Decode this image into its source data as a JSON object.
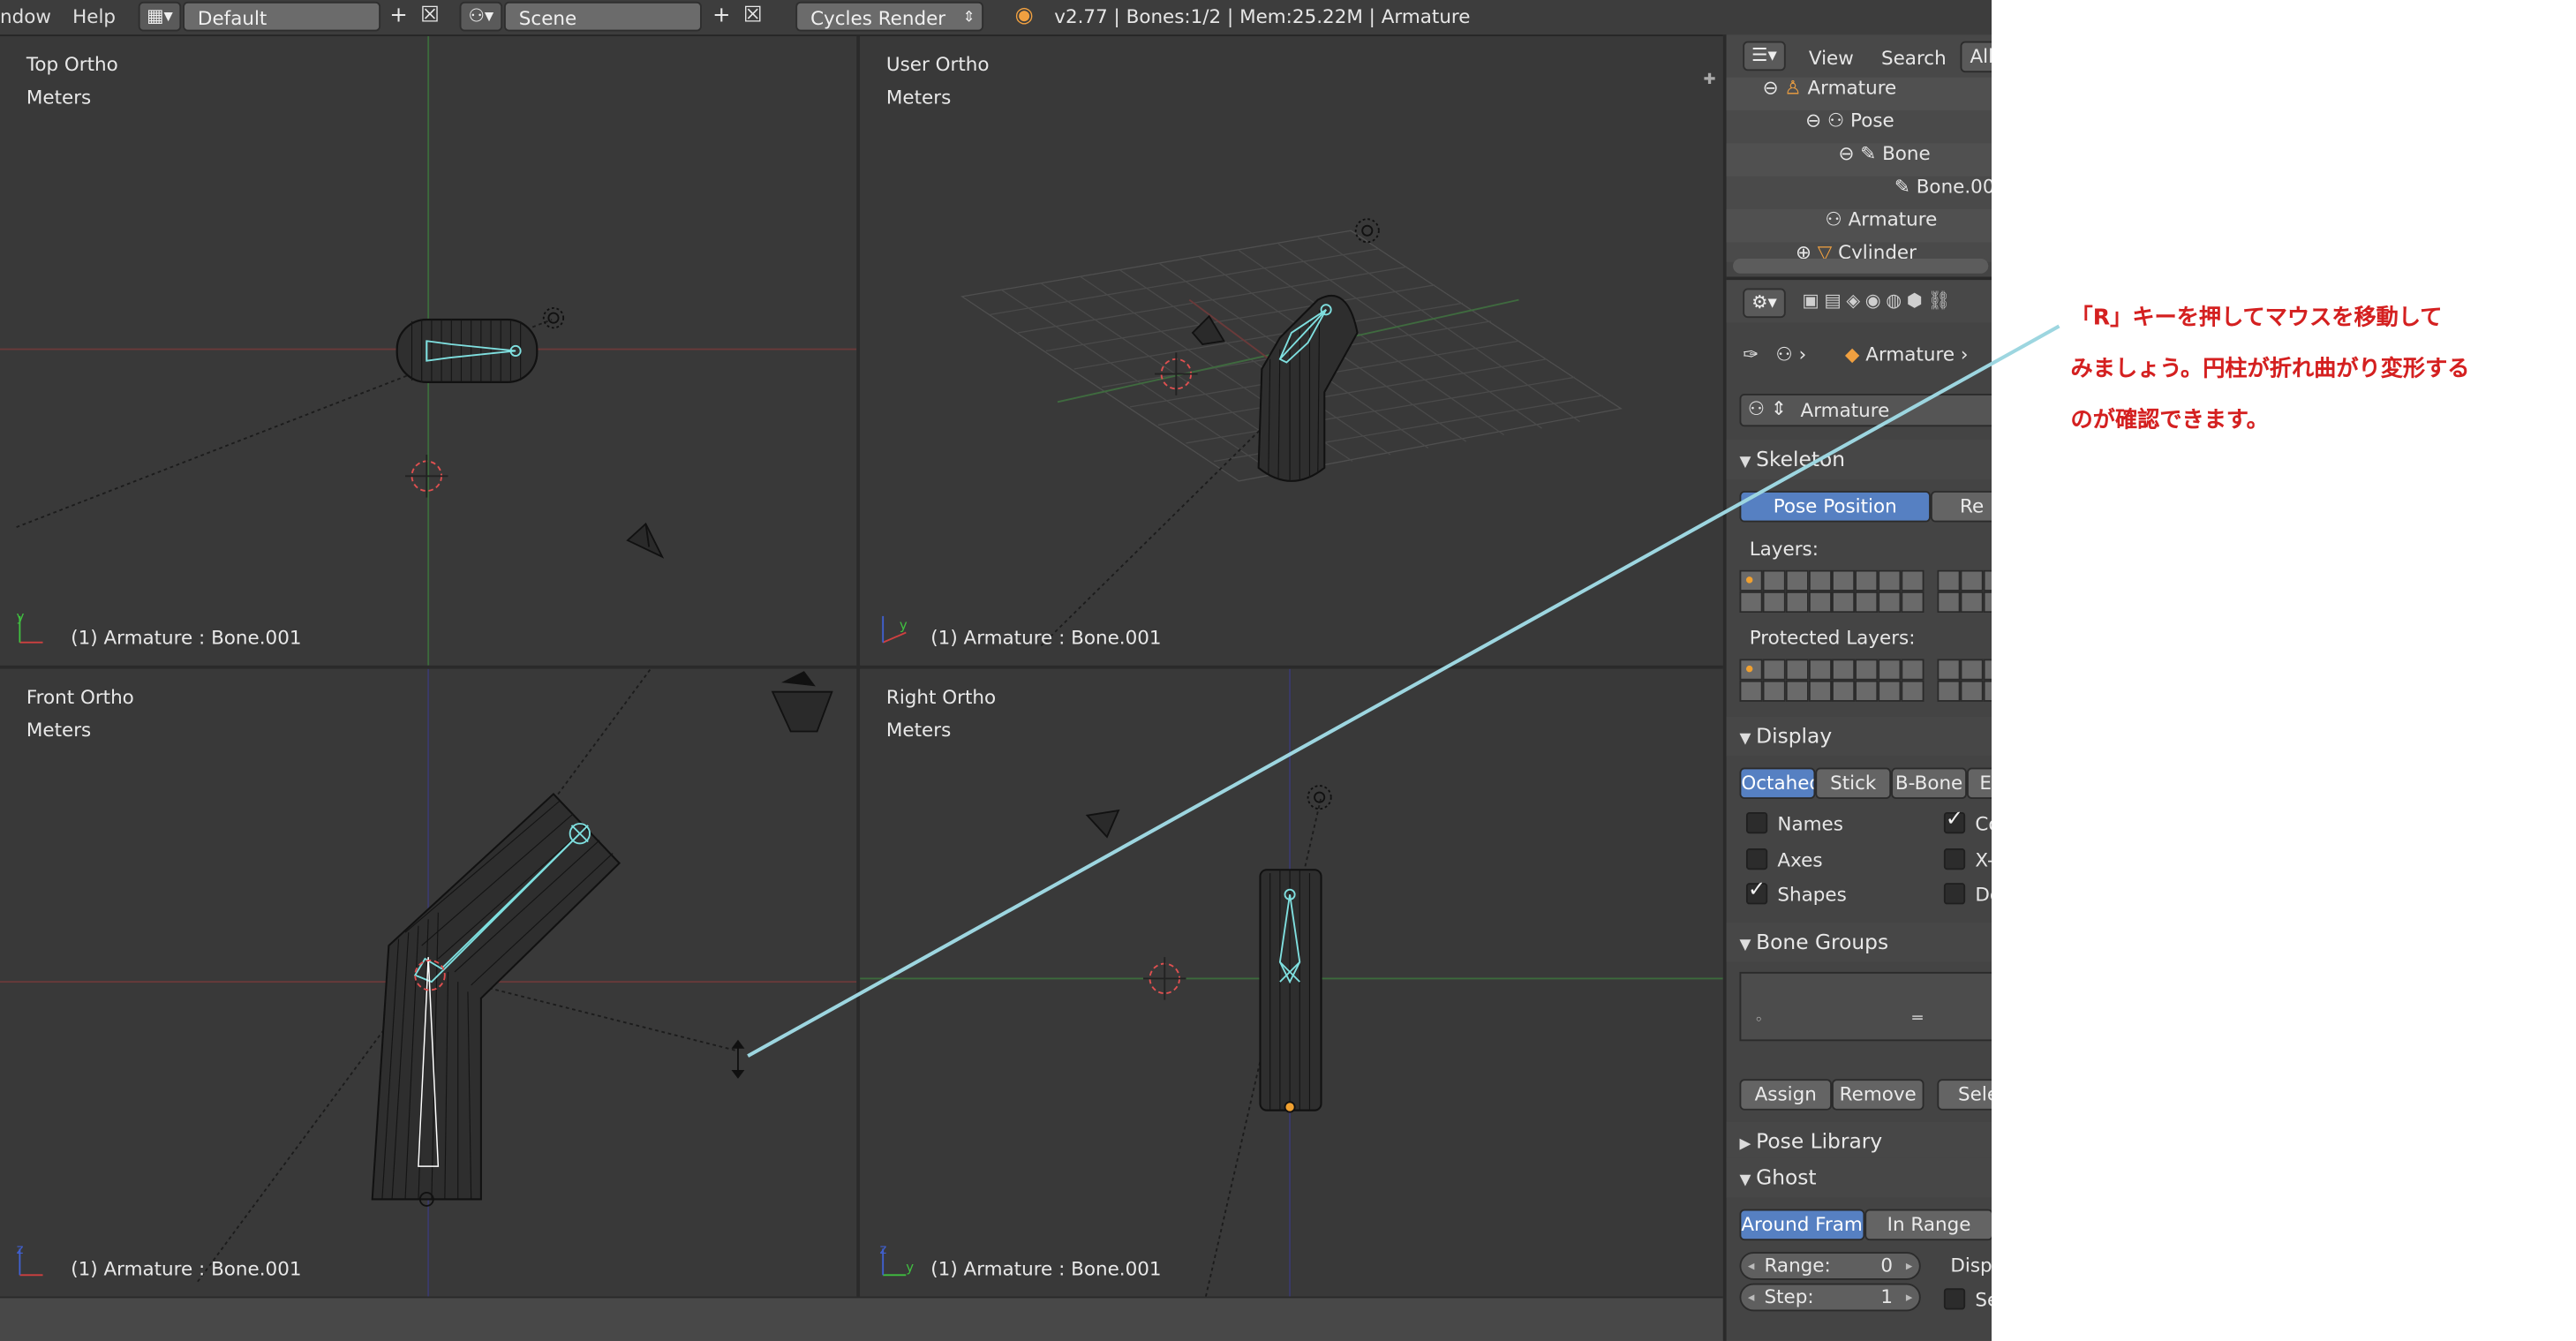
{
  "topbar": {
    "menu_window": "ndow",
    "menu_help": "Help",
    "layout_field": "Default",
    "scene_field": "Scene",
    "render_engine": "Cycles Render",
    "status": "v2.77 | Bones:1/2  | Mem:25.22M | Armature"
  },
  "viewports": {
    "top": {
      "title": "Top Ortho",
      "units": "Meters",
      "object": "(1) Armature : Bone.001"
    },
    "user": {
      "title": "User Ortho",
      "units": "Meters",
      "object": "(1) Armature : Bone.001"
    },
    "front": {
      "title": "Front Ortho",
      "units": "Meters",
      "object": "(1) Armature : Bone.001"
    },
    "right": {
      "title": "Right Ortho",
      "units": "Meters",
      "object": "(1) Armature : Bone.001"
    }
  },
  "outliner": {
    "header": {
      "view": "View",
      "search": "Search",
      "all": "All"
    },
    "items": [
      "Armature",
      "Pose",
      "Bone",
      "Bone.00",
      "Armature",
      "Cylinder"
    ]
  },
  "properties": {
    "breadcrumb": "Armature",
    "datablock": "Armature",
    "skeleton": {
      "header": "Skeleton",
      "pose_position": "Pose Position",
      "rest_position": "Re",
      "layers_label": "Layers:",
      "protected_label": "Protected Layers:"
    },
    "display": {
      "header": "Display",
      "modes": [
        "Octahed",
        "Stick",
        "B-Bone",
        "En"
      ],
      "names": "Names",
      "axes": "Axes",
      "shapes": "Shapes",
      "col2": [
        "Co",
        "X-",
        "De"
      ]
    },
    "bone_groups": {
      "header": "Bone Groups",
      "assign": "Assign",
      "remove": "Remove",
      "select": "Sele"
    },
    "pose_library": {
      "header": "Pose Library"
    },
    "ghost": {
      "header": "Ghost",
      "around_frame": "Around Frame",
      "in_range": "In Range",
      "range_label": "Range:",
      "range_value": "0",
      "step_label": "Step:",
      "step_value": "1",
      "display_label": "Displa",
      "sel_label": "Se"
    }
  },
  "annotation": {
    "line1": "「R」キーを押してマウスを移動して",
    "line2": "みましょう。円柱が折れ曲がり変形する",
    "line3": "のが確認できます。",
    "color": "#d42020"
  },
  "colors": {
    "accent": "#5680c2",
    "bone": "#7fe0e0",
    "pointer_line": "#9dd6e0"
  }
}
